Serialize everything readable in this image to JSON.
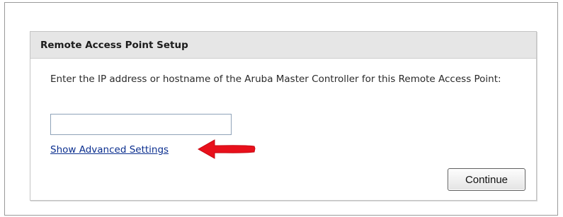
{
  "panel": {
    "title": "Remote Access Point Setup",
    "instructions": "Enter the IP address or hostname of the Aruba Master Controller for this Remote Access Point:",
    "host_input": {
      "value": "",
      "placeholder": ""
    },
    "advanced_link": "Show Advanced Settings",
    "continue_label": "Continue"
  },
  "annotation": {
    "arrow_icon": "red-arrow-left-icon",
    "arrow_color": "#e8101b"
  },
  "colors": {
    "header_bg": "#e6e6e6",
    "link": "#0b2f8f"
  }
}
